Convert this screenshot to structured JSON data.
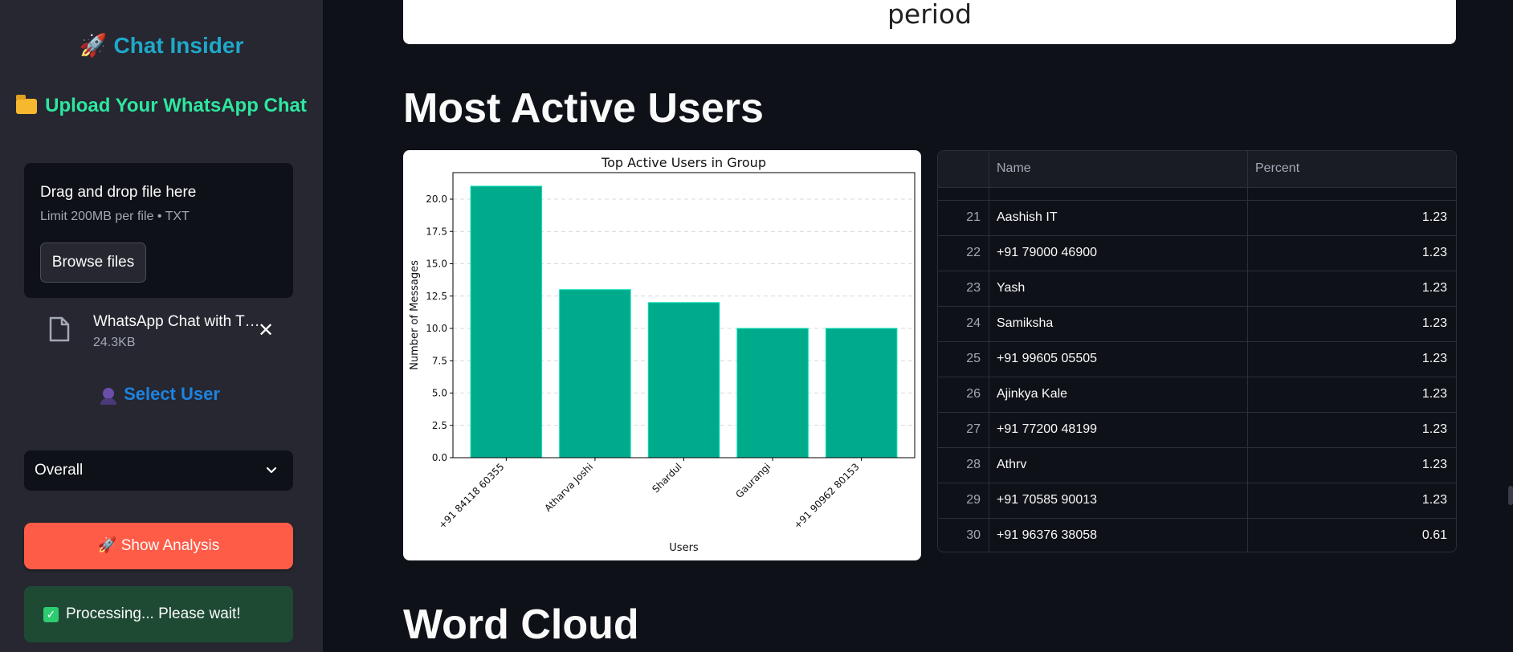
{
  "sidebar": {
    "title": "Chat Insider",
    "upload_heading": "Upload Your WhatsApp Chat",
    "dropzone": {
      "title": "Drag and drop file here",
      "limit": "Limit 200MB per file • TXT",
      "browse_label": "Browse files"
    },
    "file": {
      "name": "WhatsApp Chat with T…",
      "size": "24.3KB"
    },
    "select_user_label": "Select User",
    "user_select_value": "Overall",
    "show_analysis_label": "🚀 Show Analysis",
    "processing_text": "Processing... Please wait!"
  },
  "main": {
    "top_card_text": "period",
    "most_active_title": "Most Active Users",
    "word_cloud_title": "Word Cloud",
    "table": {
      "headers": [
        "",
        "Name",
        "Percent"
      ],
      "rows": [
        {
          "index": "21",
          "name": "Aashish IT",
          "percent": "1.23"
        },
        {
          "index": "22",
          "name": "+91 79000 46900",
          "percent": "1.23"
        },
        {
          "index": "23",
          "name": "Yash",
          "percent": "1.23"
        },
        {
          "index": "24",
          "name": "Samiksha",
          "percent": "1.23"
        },
        {
          "index": "25",
          "name": "+91 99605 05505",
          "percent": "1.23"
        },
        {
          "index": "26",
          "name": "Ajinkya Kale",
          "percent": "1.23"
        },
        {
          "index": "27",
          "name": "+91 77200 48199",
          "percent": "1.23"
        },
        {
          "index": "28",
          "name": "Athrv",
          "percent": "1.23"
        },
        {
          "index": "29",
          "name": "+91 70585 90013",
          "percent": "1.23"
        },
        {
          "index": "30",
          "name": "+91 96376 38058",
          "percent": "0.61"
        }
      ]
    }
  },
  "chart_data": {
    "type": "bar",
    "title": "Top Active Users in Group",
    "xlabel": "Users",
    "ylabel": "Number of Messages",
    "categories": [
      "+91 84118 60355",
      "Atharva Joshi",
      "Shardul",
      "Gaurangi",
      "+91 90962 80153"
    ],
    "values": [
      21,
      13,
      12,
      10,
      10
    ],
    "ylim": [
      0,
      22.05
    ],
    "yticks": [
      "0.0",
      "2.5",
      "5.0",
      "7.5",
      "10.0",
      "12.5",
      "15.0",
      "17.5",
      "20.0"
    ],
    "grid": "horizontal dashed",
    "bar_color": "#00ab8b",
    "bar_edge_color": "#00e0b8"
  },
  "colors": {
    "app_background": "#0e1117",
    "sidebar_background": "#262730",
    "title_accent": "#1fa8c9",
    "upload_accent": "#2ee6a0",
    "select_accent": "#1c83e1",
    "button_primary": "#ff5c47",
    "success_background": "#1e4a34"
  }
}
